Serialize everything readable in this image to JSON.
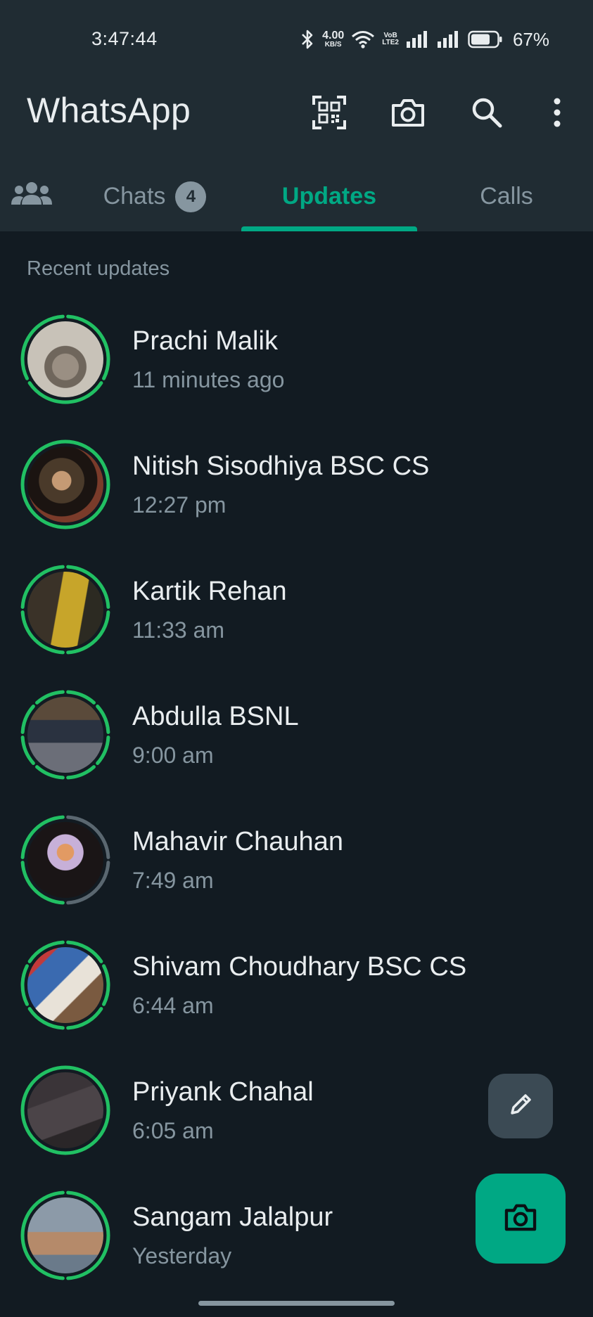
{
  "status_bar": {
    "time": "3:47:44",
    "net_speed_value": "4.00",
    "net_speed_unit": "KB/S",
    "volte_top": "VoB",
    "volte_bottom": "LTE2",
    "battery_level": "67%",
    "icons": [
      "bluetooth-icon",
      "wifi-icon",
      "signal-icon",
      "signal-icon",
      "battery-icon"
    ]
  },
  "header": {
    "title": "WhatsApp",
    "actions": [
      "qr-code-icon",
      "camera-icon",
      "search-icon",
      "more-vert-icon"
    ]
  },
  "tabs": {
    "community_icon": "community-icon",
    "chats": {
      "label": "Chats",
      "badge": "4"
    },
    "updates": {
      "label": "Updates",
      "selected": true
    },
    "calls": {
      "label": "Calls"
    }
  },
  "section": {
    "heading": "Recent updates"
  },
  "updates": [
    {
      "name": "Prachi Malik",
      "time": "11 minutes ago",
      "segments": 3,
      "viewed": 0
    },
    {
      "name": "Nitish Sisodhiya BSC CS",
      "time": "12:27 pm",
      "segments": 1,
      "viewed": 0
    },
    {
      "name": "Kartik Rehan",
      "time": "11:33 am",
      "segments": 4,
      "viewed": 0
    },
    {
      "name": "Abdulla BSNL",
      "time": "9:00 am",
      "segments": 8,
      "viewed": 0
    },
    {
      "name": "Mahavir Chauhan",
      "time": "7:49 am",
      "segments": 4,
      "viewed": 2
    },
    {
      "name": "Shivam Choudhary BSC CS",
      "time": "6:44 am",
      "segments": 6,
      "viewed": 0
    },
    {
      "name": "Priyank Chahal",
      "time": "6:05 am",
      "segments": 1,
      "viewed": 0
    },
    {
      "name": "Sangam Jalalpur",
      "time": "Yesterday",
      "segments": 2,
      "viewed": 0
    }
  ],
  "fab": {
    "pencil_icon": "pencil-icon",
    "camera_icon": "camera-icon"
  },
  "colors": {
    "accent": "#00a884",
    "unseen_ring": "#21c063",
    "seen_ring": "#5a6770",
    "header_bg": "#202c33",
    "body_bg": "#121b22",
    "secondary_text": "#8696a0"
  }
}
